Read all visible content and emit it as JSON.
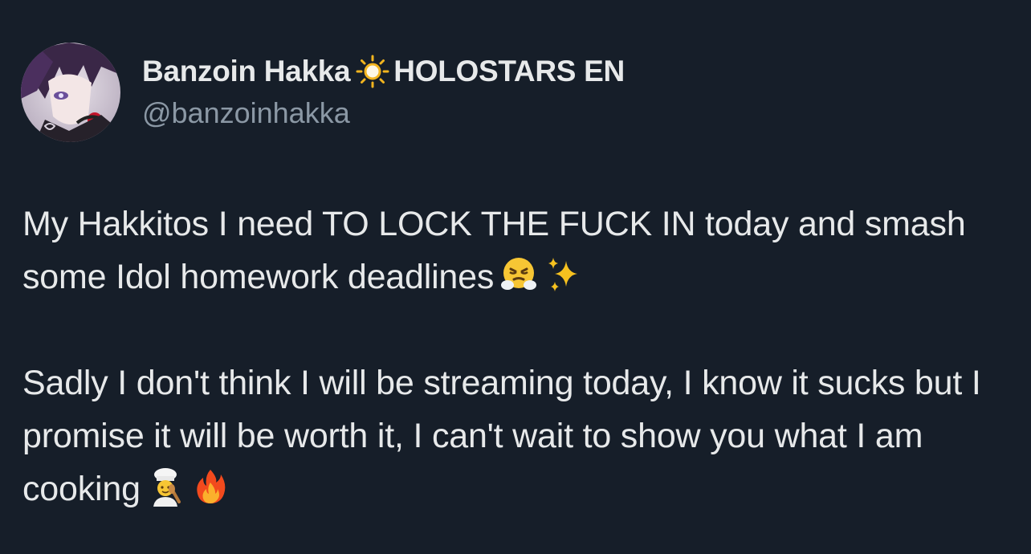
{
  "author": {
    "display_name": "Banzoin Hakka",
    "affiliation": "HOLOSTARS EN",
    "handle": "@banzoinhakka"
  },
  "tweet": {
    "line1_text": "My Hakkitos I need TO LOCK THE FUCK IN today and smash some Idol homework deadlines",
    "line2_text": "Sadly I don't think I will be streaming today, I know it sucks but I promise it will be worth it, I can't wait to show you what I am cooking"
  },
  "icons": {
    "sun": "sun-icon",
    "avatar": "avatar-image",
    "emoji_1": "face-with-steam-icon",
    "emoji_2": "sparkles-icon",
    "emoji_3": "cook-icon",
    "emoji_4": "fire-icon"
  },
  "colors": {
    "background": "#161e29",
    "primary_text": "#e7e9ea",
    "secondary_text": "#8b98a5"
  }
}
